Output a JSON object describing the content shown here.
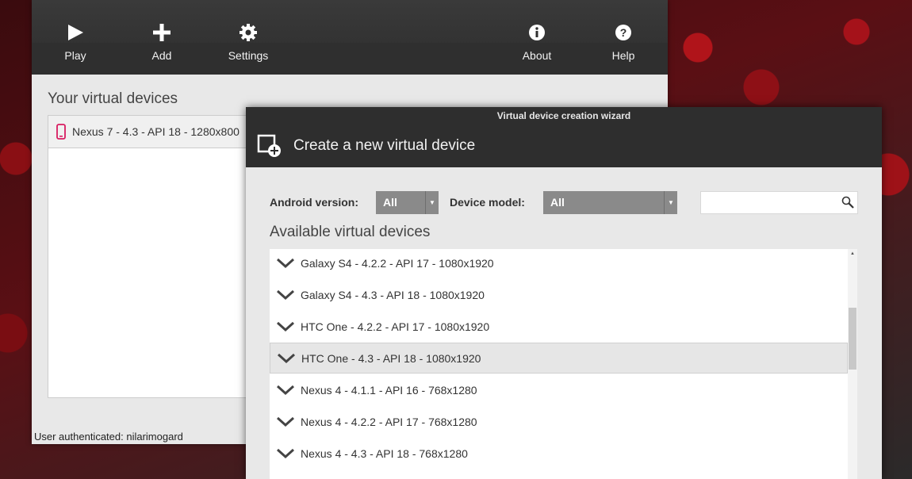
{
  "toolbar": {
    "play_label": "Play",
    "add_label": "Add",
    "settings_label": "Settings",
    "about_label": "About",
    "help_label": "Help"
  },
  "main": {
    "section_title": "Your virtual devices",
    "devices": [
      {
        "label": "Nexus 7 - 4.3 - API 18 - 1280x800",
        "icon": "phone-icon"
      }
    ],
    "status": "User authenticated: nilarimogard"
  },
  "wizard": {
    "window_title": "Virtual device creation wizard",
    "header_title": "Create a new virtual device",
    "android_version_label": "Android version:",
    "android_version_value": "All",
    "device_model_label": "Device model:",
    "device_model_value": "All",
    "search_placeholder": "",
    "available_title": "Available virtual devices",
    "available": [
      {
        "label": "Galaxy S4 - 4.2.2 - API 17 - 1080x1920"
      },
      {
        "label": "Galaxy S4 - 4.3 - API 18 - 1080x1920"
      },
      {
        "label": "HTC One - 4.2.2 - API 17 - 1080x1920"
      },
      {
        "label": "HTC One - 4.3 - API 18 - 1080x1920",
        "selected": true
      },
      {
        "label": "Nexus 4 - 4.1.1 - API 16 - 768x1280"
      },
      {
        "label": "Nexus 4 - 4.2.2 - API 17 - 768x1280"
      },
      {
        "label": "Nexus 4 - 4.3 - API 18 - 768x1280"
      }
    ]
  },
  "colors": {
    "toolbar_bg": "#2f2f2f",
    "select_bg": "#8a8a8a",
    "device_icon": "#d81b60"
  }
}
